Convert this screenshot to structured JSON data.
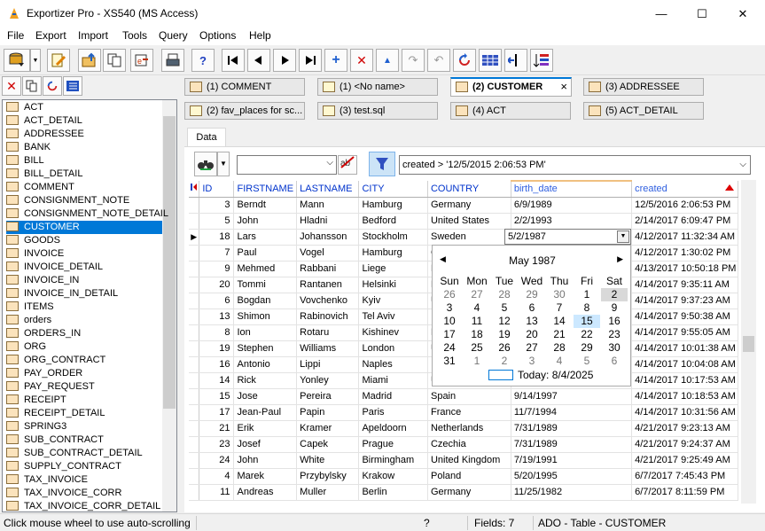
{
  "window": {
    "title": "Exportizer Pro - XS540 (MS Access)",
    "min": "—",
    "max": "☐",
    "close": "✕"
  },
  "menu": [
    "File",
    "Export",
    "Import",
    "Tools",
    "Query",
    "Options",
    "Help"
  ],
  "table_list": [
    "ACT",
    "ACT_DETAIL",
    "ADDRESSEE",
    "BANK",
    "BILL",
    "BILL_DETAIL",
    "COMMENT",
    "CONSIGNMENT_NOTE",
    "CONSIGNMENT_NOTE_DETAIL",
    "CUSTOMER",
    "GOODS",
    "INVOICE",
    "INVOICE_DETAIL",
    "INVOICE_IN",
    "INVOICE_IN_DETAIL",
    "ITEMS",
    "orders",
    "ORDERS_IN",
    "ORG",
    "ORG_CONTRACT",
    "PAY_ORDER",
    "PAY_REQUEST",
    "RECEIPT",
    "RECEIPT_DETAIL",
    "SPRING3",
    "SUB_CONTRACT",
    "SUB_CONTRACT_DETAIL",
    "SUPPLY_CONTRACT",
    "TAX_INVOICE",
    "TAX_INVOICE_CORR",
    "TAX_INVOICE_CORR_DETAIL"
  ],
  "selected_table": "CUSTOMER",
  "doc_tabs": [
    {
      "label": "(1) COMMENT"
    },
    {
      "label": "(1) <No name>"
    },
    {
      "label": "(2) CUSTOMER"
    },
    {
      "label": "(3) ADDRESSEE"
    },
    {
      "label": "(2) fav_places for sc..."
    },
    {
      "label": "(3) test.sql"
    },
    {
      "label": "(4) ACT"
    },
    {
      "label": "(5) ACT_DETAIL"
    }
  ],
  "data_tab": "Data",
  "filter": {
    "expression": "created > '12/5/2015 2:06:53 PM'"
  },
  "grid": {
    "columns": [
      "ID",
      "FIRSTNAME",
      "LASTNAME",
      "CITY",
      "COUNTRY",
      "birth_date",
      "created"
    ],
    "rows": [
      [
        "3",
        "Berndt",
        "Mann",
        "Hamburg",
        "Germany",
        "6/9/1989",
        "12/5/2016 2:06:53 PM"
      ],
      [
        "5",
        "John",
        "Hladni",
        "Bedford",
        "United States",
        "2/2/1993",
        "2/14/2017 6:09:47 PM"
      ],
      [
        "18",
        "Lars",
        "Johansson",
        "Stockholm",
        "Sweden",
        "5/2/1987",
        "4/12/2017 11:32:34 AM"
      ],
      [
        "7",
        "Paul",
        "Vogel",
        "Hamburg",
        "Ge",
        "",
        "4/12/2017 1:30:02 PM"
      ],
      [
        "9",
        "Mehmed",
        "Rabbani",
        "Liege",
        "Be",
        "",
        "4/13/2017 10:50:18 PM"
      ],
      [
        "20",
        "Tommi",
        "Rantanen",
        "Helsinki",
        "Fin",
        "",
        "4/14/2017 9:35:11 AM"
      ],
      [
        "6",
        "Bogdan",
        "Vovchenko",
        "Kyiv",
        "Uk",
        "",
        "4/14/2017 9:37:23 AM"
      ],
      [
        "13",
        "Shimon",
        "Rabinovich",
        "Tel Aviv",
        "Isr",
        "",
        "4/14/2017 9:50:38 AM"
      ],
      [
        "8",
        "Ion",
        "Rotaru",
        "Kishinev",
        "Mo",
        "",
        "4/14/2017 9:55:05 AM"
      ],
      [
        "19",
        "Stephen",
        "Williams",
        "London",
        "Un",
        "",
        "4/14/2017 10:01:38 AM"
      ],
      [
        "16",
        "Antonio",
        "Lippi",
        "Naples",
        "Ita",
        "",
        "4/14/2017 10:04:08 AM"
      ],
      [
        "14",
        "Rick",
        "Yonley",
        "Miami",
        "Un",
        "",
        "4/14/2017 10:17:53 AM"
      ],
      [
        "15",
        "Jose",
        "Pereira",
        "Madrid",
        "Spain",
        "9/14/1997",
        "4/14/2017 10:18:53 AM"
      ],
      [
        "17",
        "Jean-Paul",
        "Papin",
        "Paris",
        "France",
        "11/7/1994",
        "4/14/2017 10:31:56 AM"
      ],
      [
        "21",
        "Erik",
        "Kramer",
        "Apeldoorn",
        "Netherlands",
        "7/31/1989",
        "4/21/2017 9:23:13 AM"
      ],
      [
        "23",
        "Josef",
        "Capek",
        "Prague",
        "Czechia",
        "7/31/1989",
        "4/21/2017 9:24:37 AM"
      ],
      [
        "24",
        "John",
        "White",
        "Birmingham",
        "United Kingdom",
        "7/19/1991",
        "4/21/2017 9:25:49 AM"
      ],
      [
        "4",
        "Marek",
        "Przybylsky",
        "Krakow",
        "Poland",
        "5/20/1995",
        "6/7/2017 7:45:43 PM"
      ],
      [
        "11",
        "Andreas",
        "Muller",
        "Berlin",
        "Germany",
        "11/25/1982",
        "6/7/2017 8:11:59 PM"
      ]
    ]
  },
  "edit_cell": "5/2/1987",
  "calendar": {
    "month": "May 1987",
    "dow": [
      "Sun",
      "Mon",
      "Tue",
      "Wed",
      "Thu",
      "Fri",
      "Sat"
    ],
    "weeks": [
      [
        "26",
        "27",
        "28",
        "29",
        "30",
        "1",
        "2"
      ],
      [
        "3",
        "4",
        "5",
        "6",
        "7",
        "8",
        "9"
      ],
      [
        "10",
        "11",
        "12",
        "13",
        "14",
        "15",
        "16"
      ],
      [
        "17",
        "18",
        "19",
        "20",
        "21",
        "22",
        "23"
      ],
      [
        "24",
        "25",
        "26",
        "27",
        "28",
        "29",
        "30"
      ],
      [
        "31",
        "1",
        "2",
        "3",
        "4",
        "5",
        "6"
      ]
    ],
    "today": "Today: 8/4/2025"
  },
  "status": {
    "hint": "Click mouse wheel to use auto-scrolling",
    "q": "?",
    "fields": "Fields: 7",
    "source": "ADO - Table - CUSTOMER"
  }
}
